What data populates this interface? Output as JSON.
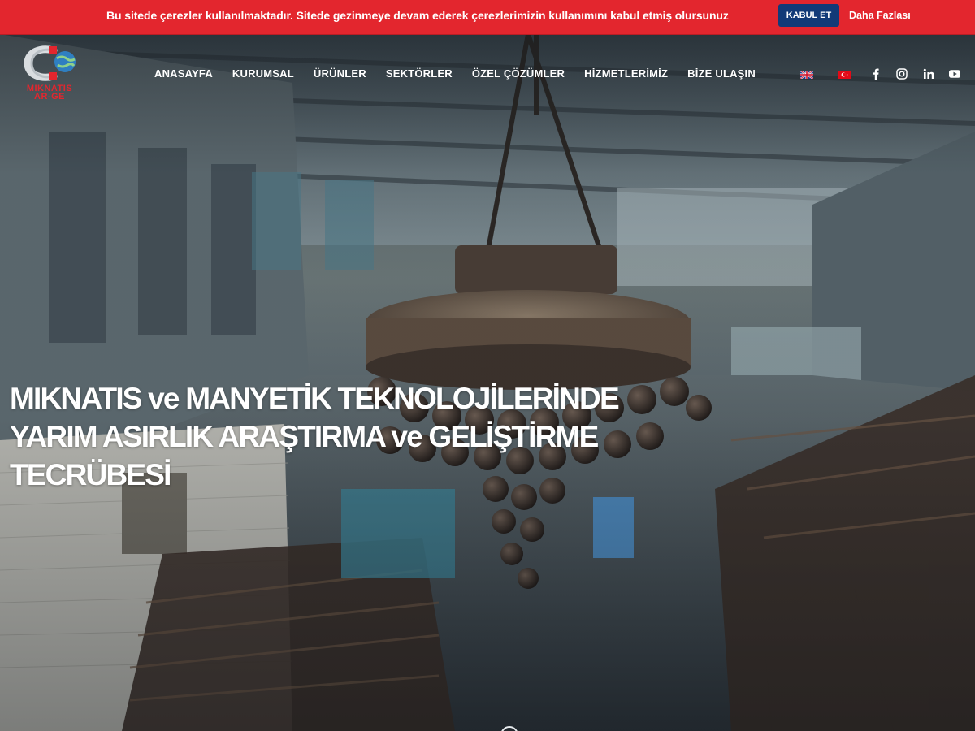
{
  "cookie_bar": {
    "message": "Bu sitede çerezler kullanılmaktadır. Sitede gezinmeye devam ederek çerezlerimizin kullanımını kabul etmiş olursunuz",
    "accept_label": "KABUL ET",
    "more_label": "Daha Fazlası",
    "background_color": "#e3262e",
    "accept_color": "#123a78"
  },
  "brand": {
    "logo_line1": "MIKNATIS",
    "logo_line2": "AR-GE",
    "brand_color": "#e3262e"
  },
  "nav": {
    "items": [
      {
        "label": "ANASAYFA"
      },
      {
        "label": "KURUMSAL"
      },
      {
        "label": "ÜRÜNLER"
      },
      {
        "label": "SEKTÖRLER"
      },
      {
        "label": "ÖZEL ÇÖZÜMLER"
      },
      {
        "label": "HİZMETLERİMİZ"
      },
      {
        "label": "BİZE ULAŞIN"
      }
    ],
    "languages": [
      {
        "icon": "uk-flag-icon"
      },
      {
        "icon": "turkey-flag-icon"
      }
    ],
    "social": [
      {
        "icon": "facebook-icon"
      },
      {
        "icon": "instagram-icon"
      },
      {
        "icon": "linkedin-icon"
      },
      {
        "icon": "youtube-icon"
      }
    ]
  },
  "hero": {
    "line1": "MIKNATIS ve MANYETİK TEKNOLOJİLERİNDE",
    "line2": "YARIM ASIRLIK ARAŞTIRMA ve GELİŞTİRME",
    "line3": "TECRÜBESİ",
    "scroll_icon": "mouse-scroll-icon"
  }
}
